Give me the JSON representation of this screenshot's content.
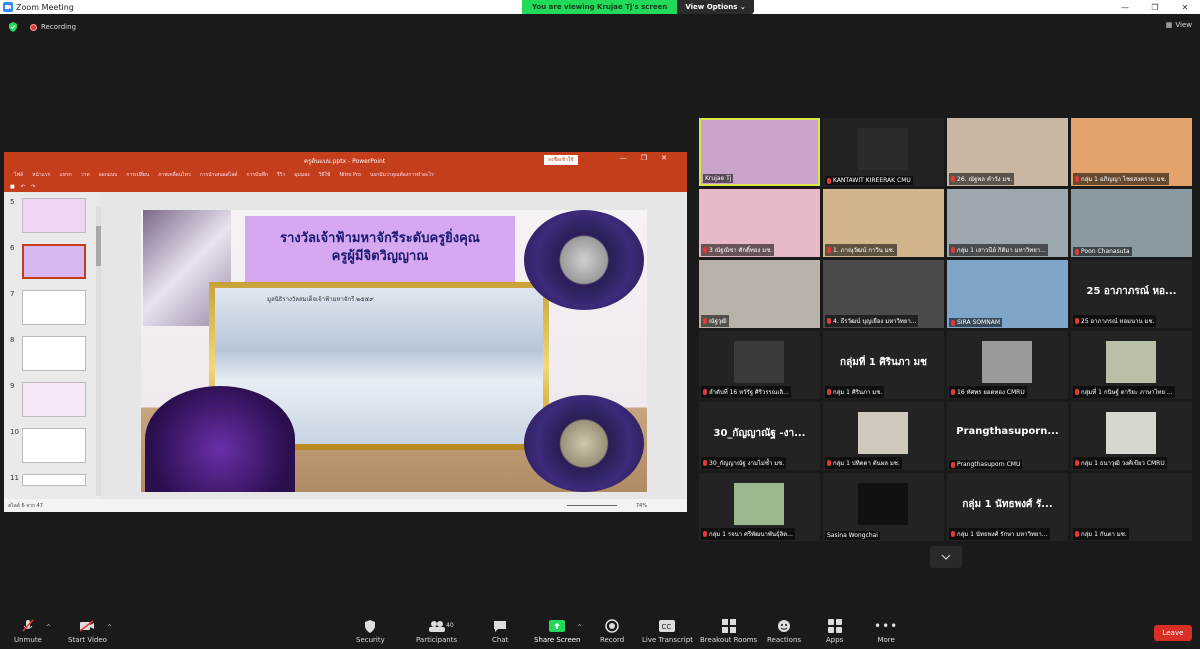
{
  "window": {
    "title": "Zoom Meeting"
  },
  "banner": {
    "viewing": "You are viewing Krujae Tj's screen",
    "view_options": "View Options"
  },
  "topbar": {
    "recording": "Recording",
    "view": "View"
  },
  "colors": {
    "accent_green": "#23d959",
    "leave_red": "#d93025",
    "active_speaker": "#d9e64a",
    "powerpoint": "#c43e1c"
  },
  "share": {
    "ppt_title": "ครูต้นแบบ.pptx  -  PowerPoint",
    "signin": "ลงชื่อเข้าใช้",
    "user": "ไฟล์",
    "ribbon": [
      "ไฟล์",
      "หน้าแรก",
      "แทรก",
      "วาด",
      "ออกแบบ",
      "การเปลี่ยน",
      "ภาพเคลื่อนไหว",
      "การนำเสนอสไลด์",
      "การบันทึก",
      "รีวิว",
      "มุมมอง",
      "วิธีใช้",
      "Nitro Pro",
      "บอกฉันว่าคุณต้องการทำอะไร"
    ],
    "slide_nums": [
      "5",
      "6",
      "7",
      "8",
      "9",
      "10",
      "11"
    ],
    "slide_title": [
      "รางวัลเจ้าฟ้ามหาจักรีระดับครูยิ่งคุณ",
      "ครูผู้มีจิตวิญญาณ"
    ],
    "photo_caption": "มูลนิธิรางวัลสมเด็จเจ้าฟ้ามหาจักรี ๒๕๕๙",
    "status": "สไลด์ 6 จาก 47",
    "zoom": "74%"
  },
  "gallery": {
    "tiles": [
      {
        "name": "Krujae Tj",
        "active": true,
        "muted": false,
        "kind": "video"
      },
      {
        "name": "KANTAWIT KIREERAK CMU",
        "muted": true,
        "kind": "video"
      },
      {
        "name": "26. ณัฐพล คำวัง มช.",
        "muted": true,
        "kind": "video"
      },
      {
        "name": "กลุ่ม 1 อภิญญา ไชยสงคราม มช.",
        "muted": true,
        "kind": "video"
      },
      {
        "name": "3 ณัฐณิชา ศักดิ์ทอง มช.",
        "muted": true,
        "kind": "video"
      },
      {
        "name": "1. ภาณุวัฒน์ กาวิน มช.",
        "muted": true,
        "kind": "video"
      },
      {
        "name": "กลุ่ม 1 เสาวนีย์ กิติมา มหาวิทยา...",
        "muted": true,
        "kind": "video"
      },
      {
        "name": "Poon Chanasuta",
        "muted": true,
        "kind": "video"
      },
      {
        "name": "ณัฐวุฒิ",
        "muted": true,
        "kind": "video"
      },
      {
        "name": "4. ธีรวัฒน์ บุญเยือง มหาวิทยา...",
        "muted": true,
        "kind": "video"
      },
      {
        "name": "SIRA SOMNAM",
        "muted": true,
        "kind": "video"
      },
      {
        "name": "25 อาภาภรณ์ หอมนาน มช.",
        "muted": true,
        "kind": "text",
        "big": "25 อาภาภรณ์ หอ..."
      },
      {
        "name": "ลำดับที่ 16 หวัรัฐ ศิริวรรณเลิ...",
        "muted": true,
        "kind": "video"
      },
      {
        "name": "กลุ่ม 1 ศิรินภา มช.",
        "muted": true,
        "kind": "text",
        "big": "กลุ่มที่ 1 ศิรินภา มช"
      },
      {
        "name": "16 ทัศพร ยอดทอง CMRU",
        "muted": true,
        "kind": "video"
      },
      {
        "name": "กลุ่มที่ 1 กนิษฐ์ ดาริยะ ภาษาไทย ...",
        "muted": true,
        "kind": "video"
      },
      {
        "name": "30_กัญญาณัฐ งามไม่ซ้ำ มช.",
        "muted": true,
        "kind": "text",
        "big": "30_กัญญาณัฐ -งา..."
      },
      {
        "name": "กลุ่ม 1 ปทิตตา ตันผล มช.",
        "muted": true,
        "kind": "video"
      },
      {
        "name": "Prangthasuporn CMU",
        "muted": true,
        "kind": "text",
        "big": "Prangthasuporn..."
      },
      {
        "name": "กลุ่ม 1 ธนาวุฒิ วงศ์เขียว CMRU",
        "muted": true,
        "kind": "video"
      },
      {
        "name": "กลุ่ม 1 รจนา ศรีพัฒนาพันธุ์ลิต...",
        "muted": true,
        "kind": "video"
      },
      {
        "name": "Sasina Wongchai",
        "muted": false,
        "kind": "video"
      },
      {
        "name": "กลุ่ม 1 นัทธพงศ์ รักษา มหาวิทยา...",
        "muted": true,
        "kind": "text",
        "big": "กลุ่ม 1 นัทธพงศ์ รั..."
      },
      {
        "name": "กลุ่ม 1 กันตา มช.",
        "muted": true,
        "kind": "video"
      }
    ]
  },
  "toolbar": {
    "unmute": "Unmute",
    "start_video": "Start Video",
    "security": "Security",
    "participants": "Participants",
    "participant_count": "40",
    "chat": "Chat",
    "share_screen": "Share Screen",
    "record": "Record",
    "live_transcript": "Live Transcript",
    "breakout": "Breakout Rooms",
    "reactions": "Reactions",
    "apps": "Apps",
    "more": "More",
    "leave": "Leave"
  },
  "icons": [
    "zoom-logo-icon",
    "shield-icon",
    "record-dot-icon",
    "grid-view-icon",
    "mic-muted-icon",
    "video-off-icon",
    "security-shield-icon",
    "participants-icon",
    "chat-icon",
    "share-screen-icon",
    "record-icon",
    "cc-icon",
    "breakout-icon",
    "reactions-icon",
    "apps-icon",
    "more-icon",
    "chevron-down-icon"
  ]
}
